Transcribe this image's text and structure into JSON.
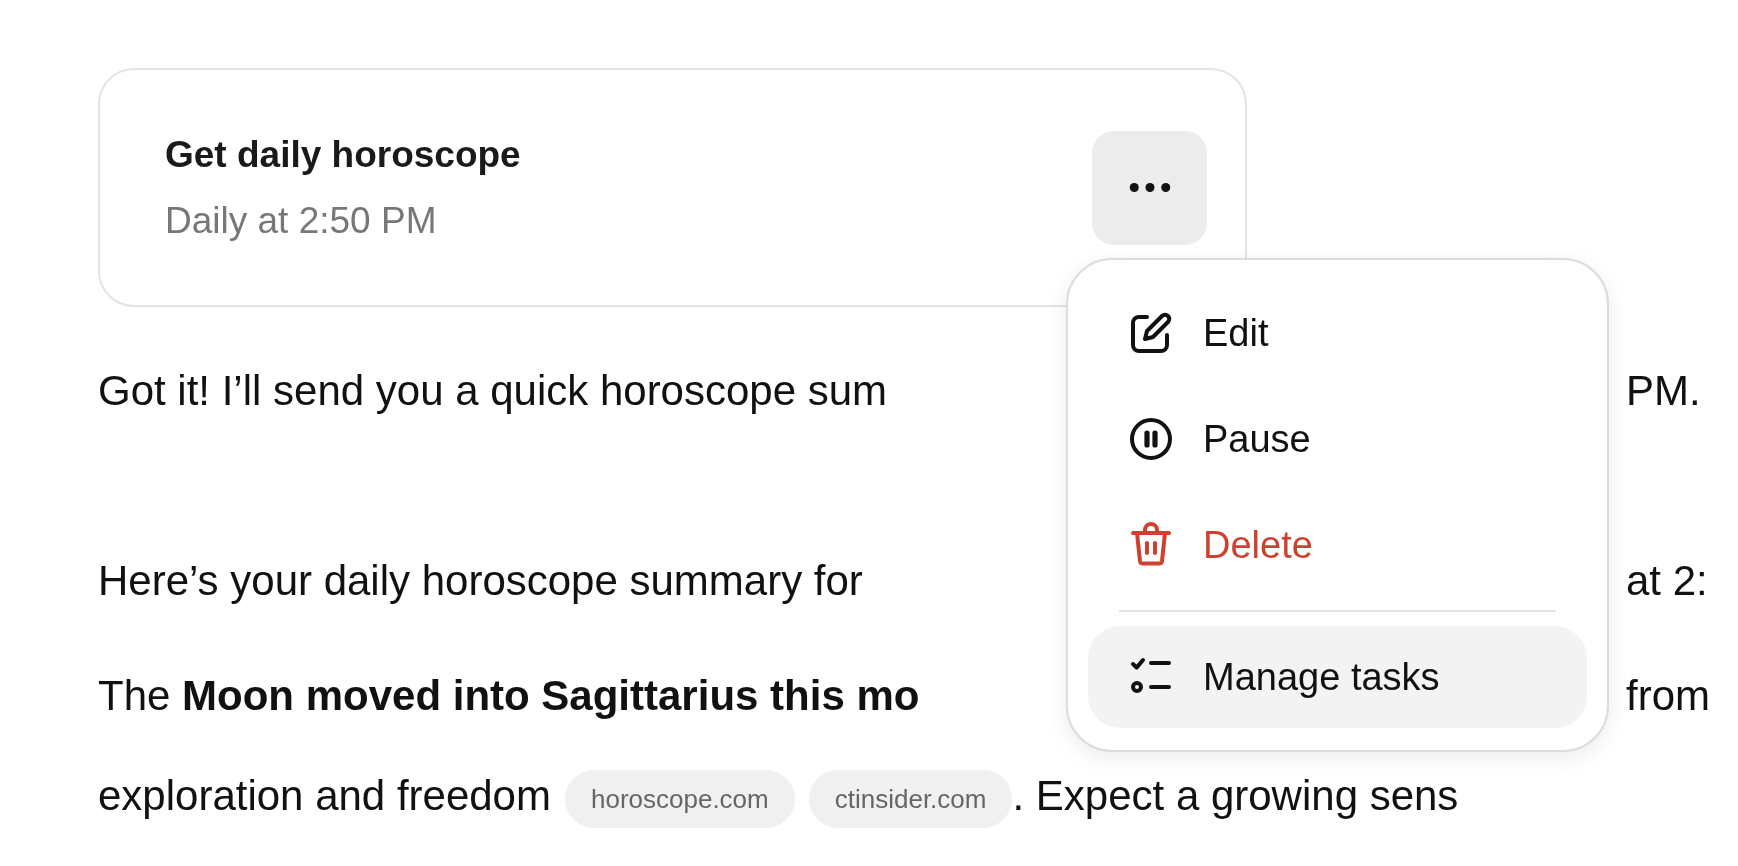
{
  "task_card": {
    "title": "Get daily horoscope",
    "schedule": "Daily at 2:50 PM"
  },
  "menu": {
    "items": [
      {
        "label": "Edit",
        "kind": "edit",
        "selected": false,
        "separated": false
      },
      {
        "label": "Pause",
        "kind": "pause",
        "selected": false,
        "separated": false
      },
      {
        "label": "Delete",
        "kind": "delete",
        "selected": false,
        "separated": false
      },
      {
        "label": "Manage tasks",
        "kind": "tasks",
        "selected": true,
        "separated": true
      }
    ]
  },
  "message": {
    "lines": [
      {
        "kind": "split",
        "left": "Got it! I’ll send you a quick horoscope sum",
        "right": "PM."
      },
      {
        "kind": "split",
        "left": "Here’s your daily horoscope summary for",
        "right": "at 2:"
      },
      {
        "kind": "split",
        "left": "The **Moon moved into Sagittarius this mo**",
        "right": "from"
      },
      {
        "kind": "flow",
        "text": "exploration and freedom",
        "sources": [
          "horoscope.com",
          "ctinsider.com"
        ],
        "after": ". Expect a growing sens"
      }
    ]
  }
}
